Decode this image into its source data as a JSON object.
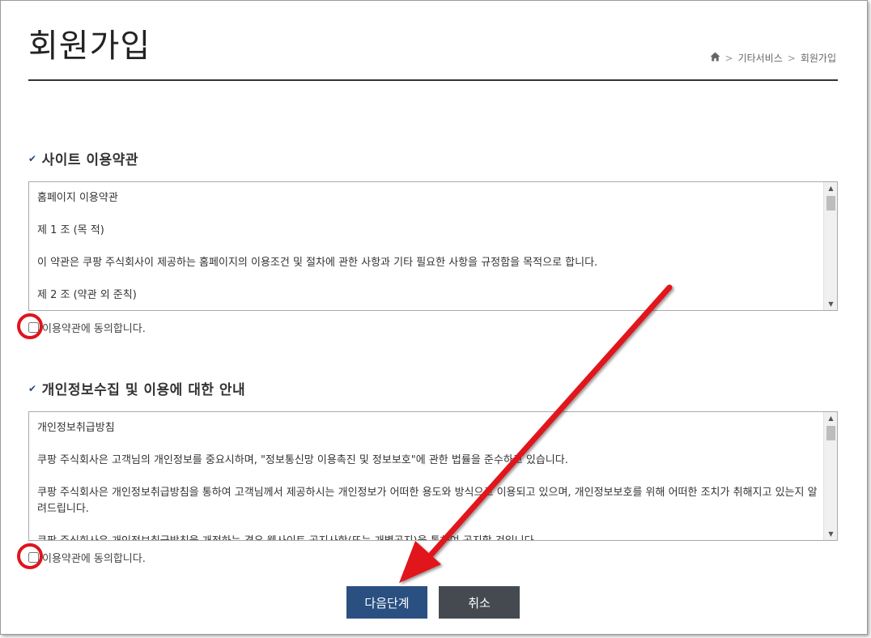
{
  "page": {
    "title": "회원가입",
    "breadcrumb": [
      "기타서비스",
      "회원가입"
    ],
    "breadcrumb_separator": ">"
  },
  "sections": [
    {
      "heading": "사이트 이용약관",
      "paragraphs": [
        "홈페이지 이용약관",
        "제 1 조 (목 적)",
        "이 약관은 쿠팡 주식회사이 제공하는 홈페이지의 이용조건 및 절차에 관한 사항과 기타 필요한 사항을 규정함을 목적으로 합니다.",
        "제 2 조 (약관 외 준칙)"
      ],
      "agree_label": "이용약관에 동의합니다."
    },
    {
      "heading": "개인정보수집 및 이용에 대한 안내",
      "paragraphs": [
        "개인정보취급방침",
        "쿠팡 주식회사은 고객님의 개인정보를 중요시하며, \"정보통신망 이용촉진 및 정보보호\"에 관한 법률을 준수하고 있습니다.",
        "쿠팡 주식회사은 개인정보취급방침을 통하여 고객님께서 제공하시는 개인정보가 어떠한 용도와 방식으로 이용되고 있으며, 개인정보보호를 위해 어떠한 조치가 취해지고 있는지 알려드립니다.",
        "쿠팡 주식회사은 개인정보취급방침을 개정하는 경우 웹사이트 공지사항(또는 개별공지)을 통하여 공지할 것입니다."
      ],
      "agree_label": "이용약관에 동의합니다."
    }
  ],
  "buttons": {
    "next": "다음단계",
    "cancel": "취소"
  },
  "colors": {
    "primary_button": "#2a5082",
    "cancel_button": "#444a50",
    "annotation": "#e0141e"
  },
  "icons": {
    "home": "home-icon",
    "section_marker": "check-icon"
  }
}
